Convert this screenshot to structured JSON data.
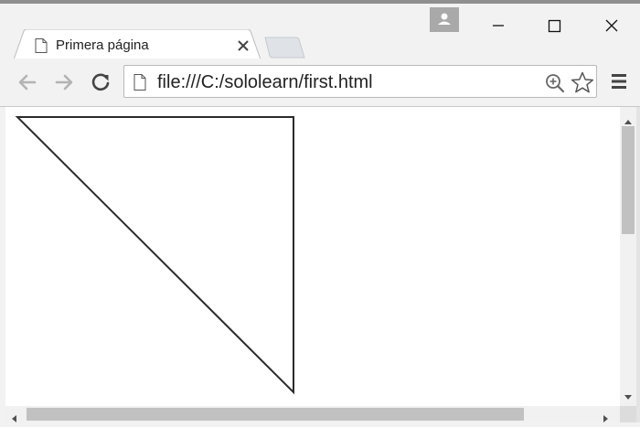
{
  "browser": {
    "tab": {
      "title": "Primera página",
      "favicon": "page-icon",
      "close_icon": "close-icon"
    },
    "window_controls": [
      "minimize-icon",
      "maximize-icon",
      "close-icon"
    ],
    "profile_icon": "profile-icon",
    "toolbar": {
      "back_icon": "arrow-left-icon",
      "forward_icon": "arrow-right-icon",
      "reload_icon": "reload-icon",
      "url": "file:///C:/sololearn/first.html",
      "zoom_icon": "zoom-in-icon",
      "bookmark_icon": "star-icon",
      "menu_icon": "hamburger-menu-icon"
    }
  },
  "page": {
    "canvas": {
      "stroke_color": "#2b2b2b",
      "shape": "triangle"
    }
  },
  "colors": {
    "chrome_bg": "#f2f2f2",
    "scrollbar_thumb": "#c1c1c1"
  }
}
